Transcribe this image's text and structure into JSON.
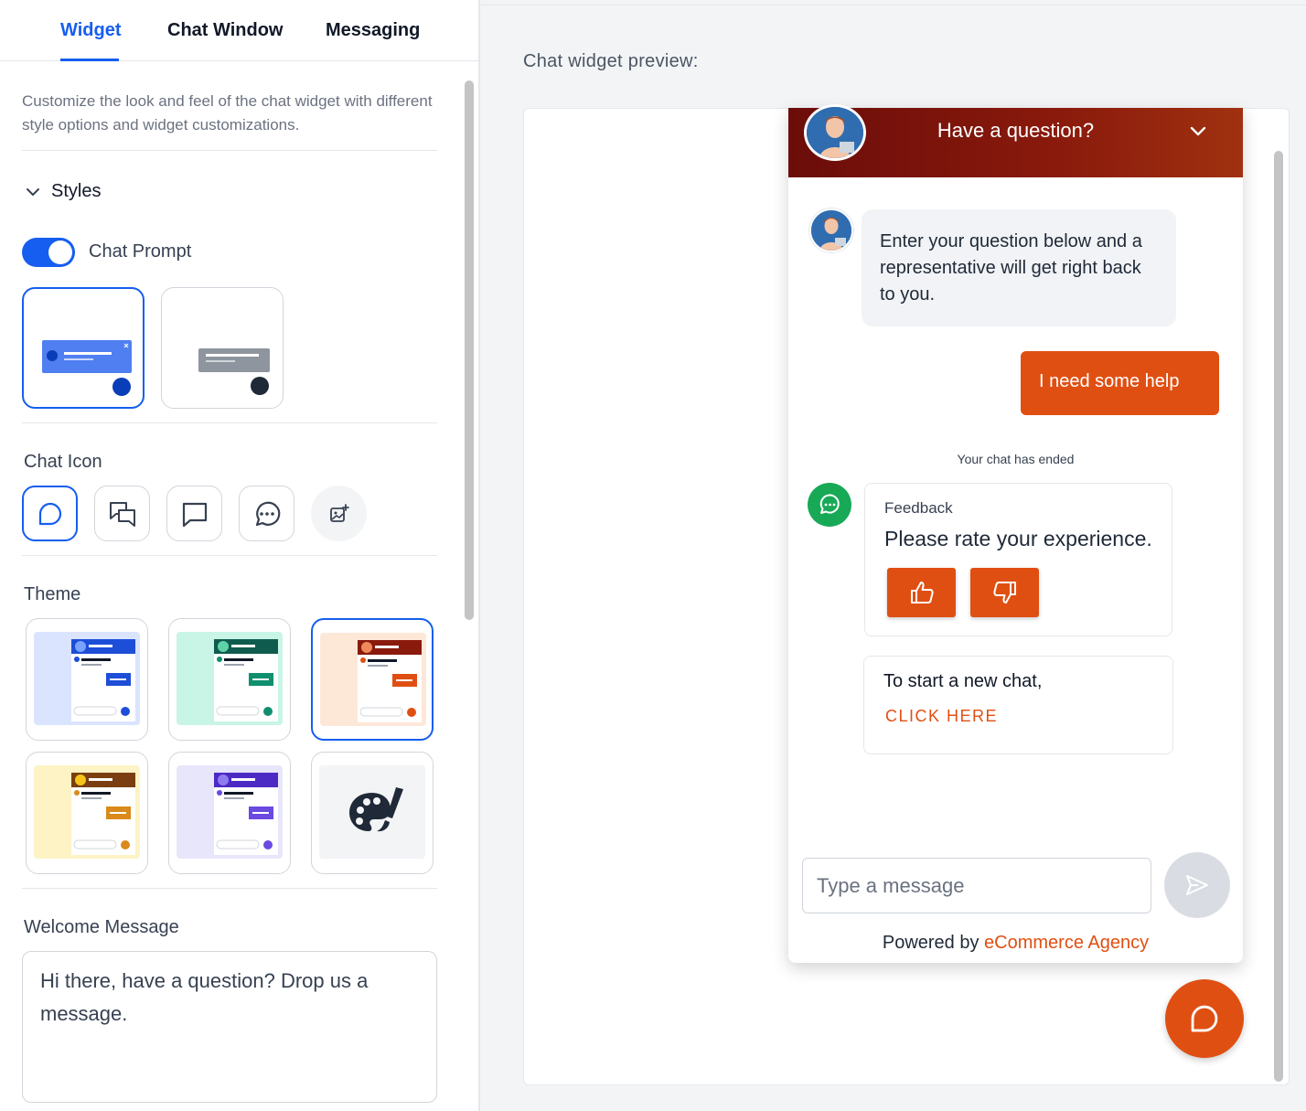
{
  "tabs": [
    {
      "label": "Widget",
      "active": true
    },
    {
      "label": "Chat Window",
      "active": false
    },
    {
      "label": "Messaging",
      "active": false
    }
  ],
  "description": "Customize the look and feel of the chat widget with different style options and widget customizations.",
  "styles": {
    "heading": "Styles",
    "chat_prompt_label": "Chat Prompt",
    "chat_prompt_enabled": true,
    "prompt_options": [
      "prompt-blue",
      "prompt-gray"
    ],
    "selected_prompt": 0
  },
  "chat_icon": {
    "heading": "Chat Icon",
    "options": [
      "chat-bubble-round-icon",
      "chat-bubbles-double-icon",
      "chat-bubble-square-icon",
      "chat-bubble-dots-icon",
      "upload-image-icon"
    ],
    "selected": 0
  },
  "theme": {
    "heading": "Theme",
    "options": [
      {
        "name": "blue",
        "bg": "#dbe4ff",
        "header": "#1d4ed8",
        "accent": "#1d4ed8"
      },
      {
        "name": "teal",
        "bg": "#c8f5e6",
        "header": "#0f5c4e",
        "accent": "#0f8f6e"
      },
      {
        "name": "orange",
        "bg": "#fde8d8",
        "header": "#8a1a0c",
        "accent": "#e04f12"
      },
      {
        "name": "yellow",
        "bg": "#fdf3c4",
        "header": "#7a3e10",
        "accent": "#d98a1a"
      },
      {
        "name": "purple",
        "bg": "#e8e6fb",
        "header": "#4c2bc4",
        "accent": "#6a4ae0"
      },
      {
        "name": "custom",
        "bg": "#f3f4f6",
        "icon": "palette-icon"
      }
    ],
    "selected": 2
  },
  "welcome": {
    "heading": "Welcome Message",
    "value": "Hi there, have a question? Drop us a message."
  },
  "preview": {
    "label": "Chat widget preview:",
    "header_title": "Have a question?",
    "agent_message": "Enter your question below and a representative will get right back to you.",
    "user_message": "I need some help",
    "chat_ended": "Your chat has ended",
    "feedback_title": "Feedback",
    "feedback_question": "Please rate your experience.",
    "new_chat_text": "To start a new chat,",
    "new_chat_link": "CLICK HERE",
    "input_placeholder": "Type a message",
    "powered_by": "Powered by",
    "powered_brand": "eCommerce Agency"
  },
  "colors": {
    "primary": "#155eef",
    "brand_accent": "#e04f12",
    "header_dark": "#6b0d0a",
    "feedback_green": "#18a957"
  }
}
